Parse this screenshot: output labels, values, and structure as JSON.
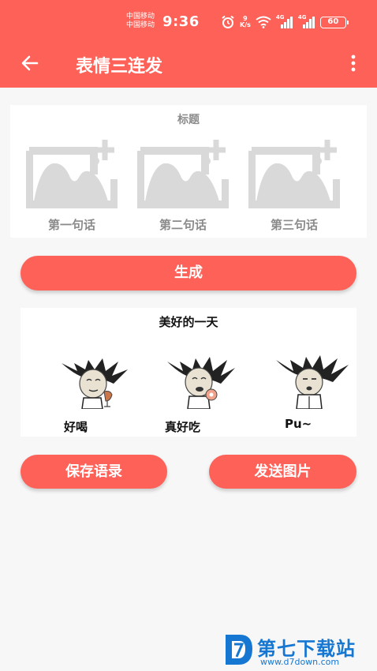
{
  "status_bar": {
    "carrier": "中国移动\n中国移动",
    "time": "9:36",
    "speed_value": "9",
    "speed_unit": "K/s",
    "net_4g_1": "4G",
    "net_4g_2": "4G",
    "battery": "60"
  },
  "toolbar": {
    "title": "表情三连发",
    "back_icon": "arrow-left-icon",
    "more_icon": "more-vert-icon"
  },
  "editor": {
    "title_placeholder": "标题",
    "slots": [
      {
        "label": "第一句话",
        "icon": "add-image-icon"
      },
      {
        "label": "第二句话",
        "icon": "add-image-icon"
      },
      {
        "label": "第三句话",
        "icon": "add-image-icon"
      }
    ]
  },
  "actions": {
    "generate": "生成",
    "save": "保存语录",
    "send": "发送图片"
  },
  "preview": {
    "title": "美好的一天",
    "captions": [
      "好喝",
      "真好吃",
      "Pu~"
    ]
  },
  "watermark": {
    "text": "第七下载站",
    "url": "www.d7down.com"
  },
  "colors": {
    "accent": "#fd6158",
    "placeholder_gray": "#d9d9d9",
    "label_gray": "#8a8a8a",
    "watermark_blue": "#1677d2"
  }
}
